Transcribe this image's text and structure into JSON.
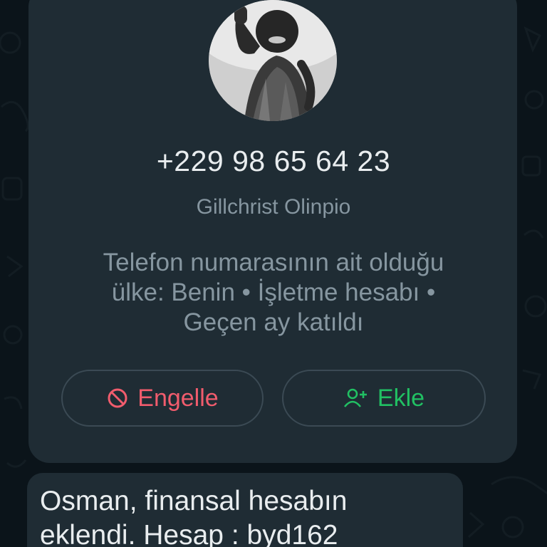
{
  "contact_card": {
    "phone_number": "+229 98 65 64 23",
    "profile_name": "Gillchrist Olinpio",
    "meta_text": "Telefon numarasının ait olduğu ülke: Benin • İşletme hesabı • Geçen ay katıldı",
    "block_button": {
      "label": "Engelle",
      "icon": "block-icon",
      "color": "#f15c6d"
    },
    "add_button": {
      "label": "Ekle",
      "icon": "add-contact-icon",
      "color": "#21c063"
    }
  },
  "message": {
    "text": "Osman, finansal hesabın eklendi. Hesap : byd162"
  },
  "colors": {
    "background": "#0b141a",
    "card": "#1f2c34",
    "primary_text": "#e9edef",
    "secondary_text": "#8696a0",
    "button_border": "#3b4a54"
  }
}
